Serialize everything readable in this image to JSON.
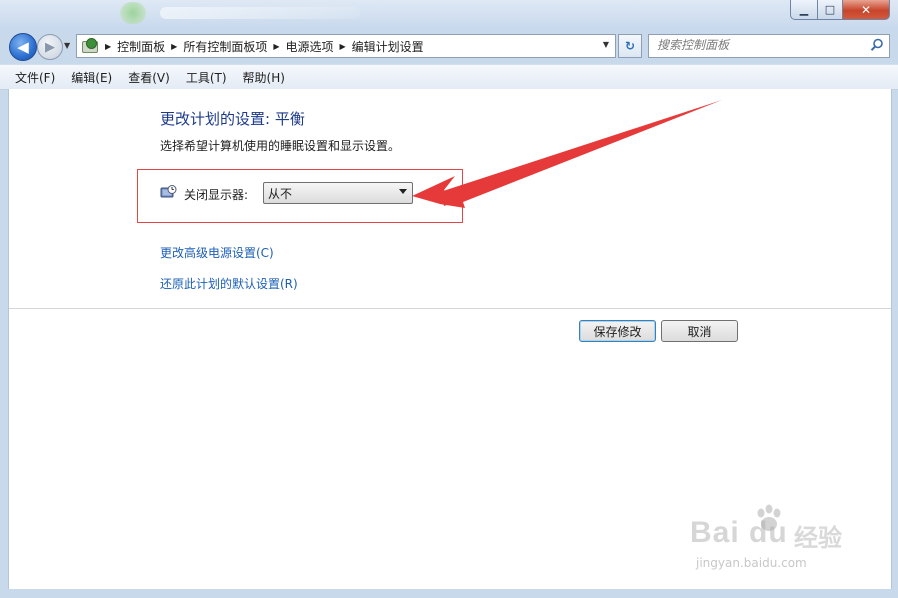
{
  "window": {
    "controls": {
      "minimize": "▁",
      "maximize": "□",
      "close": "✕"
    }
  },
  "navbar": {
    "back_glyph": "◀",
    "forward_glyph": "▶",
    "history_glyph": "▼",
    "breadcrumbs": [
      "控制面板",
      "所有控制面板项",
      "电源选项",
      "编辑计划设置"
    ],
    "breadcrumb_separator": "▶",
    "address_dropdown_glyph": "▼",
    "refresh_glyph": "↻",
    "search": {
      "placeholder": "搜索控制面板"
    }
  },
  "menu": {
    "items": [
      "文件(F)",
      "编辑(E)",
      "查看(V)",
      "工具(T)",
      "帮助(H)"
    ]
  },
  "main": {
    "title": "更改计划的设置: 平衡",
    "description": "选择希望计算机使用的睡眠设置和显示设置。",
    "display_off": {
      "label": "关闭显示器:",
      "selected": "从不"
    },
    "links": {
      "advanced": "更改高级电源设置(C)",
      "restore": "还原此计划的默认设置(R)"
    },
    "buttons": {
      "save": "保存修改",
      "cancel": "取消"
    }
  },
  "watermark": {
    "brand": "Bai du",
    "brand_cn": "经验",
    "url": "jingyan.baidu.com"
  },
  "colors": {
    "accent_title": "#1e3a8a",
    "link": "#1d5fb5",
    "annotation": "#e63a3a"
  }
}
